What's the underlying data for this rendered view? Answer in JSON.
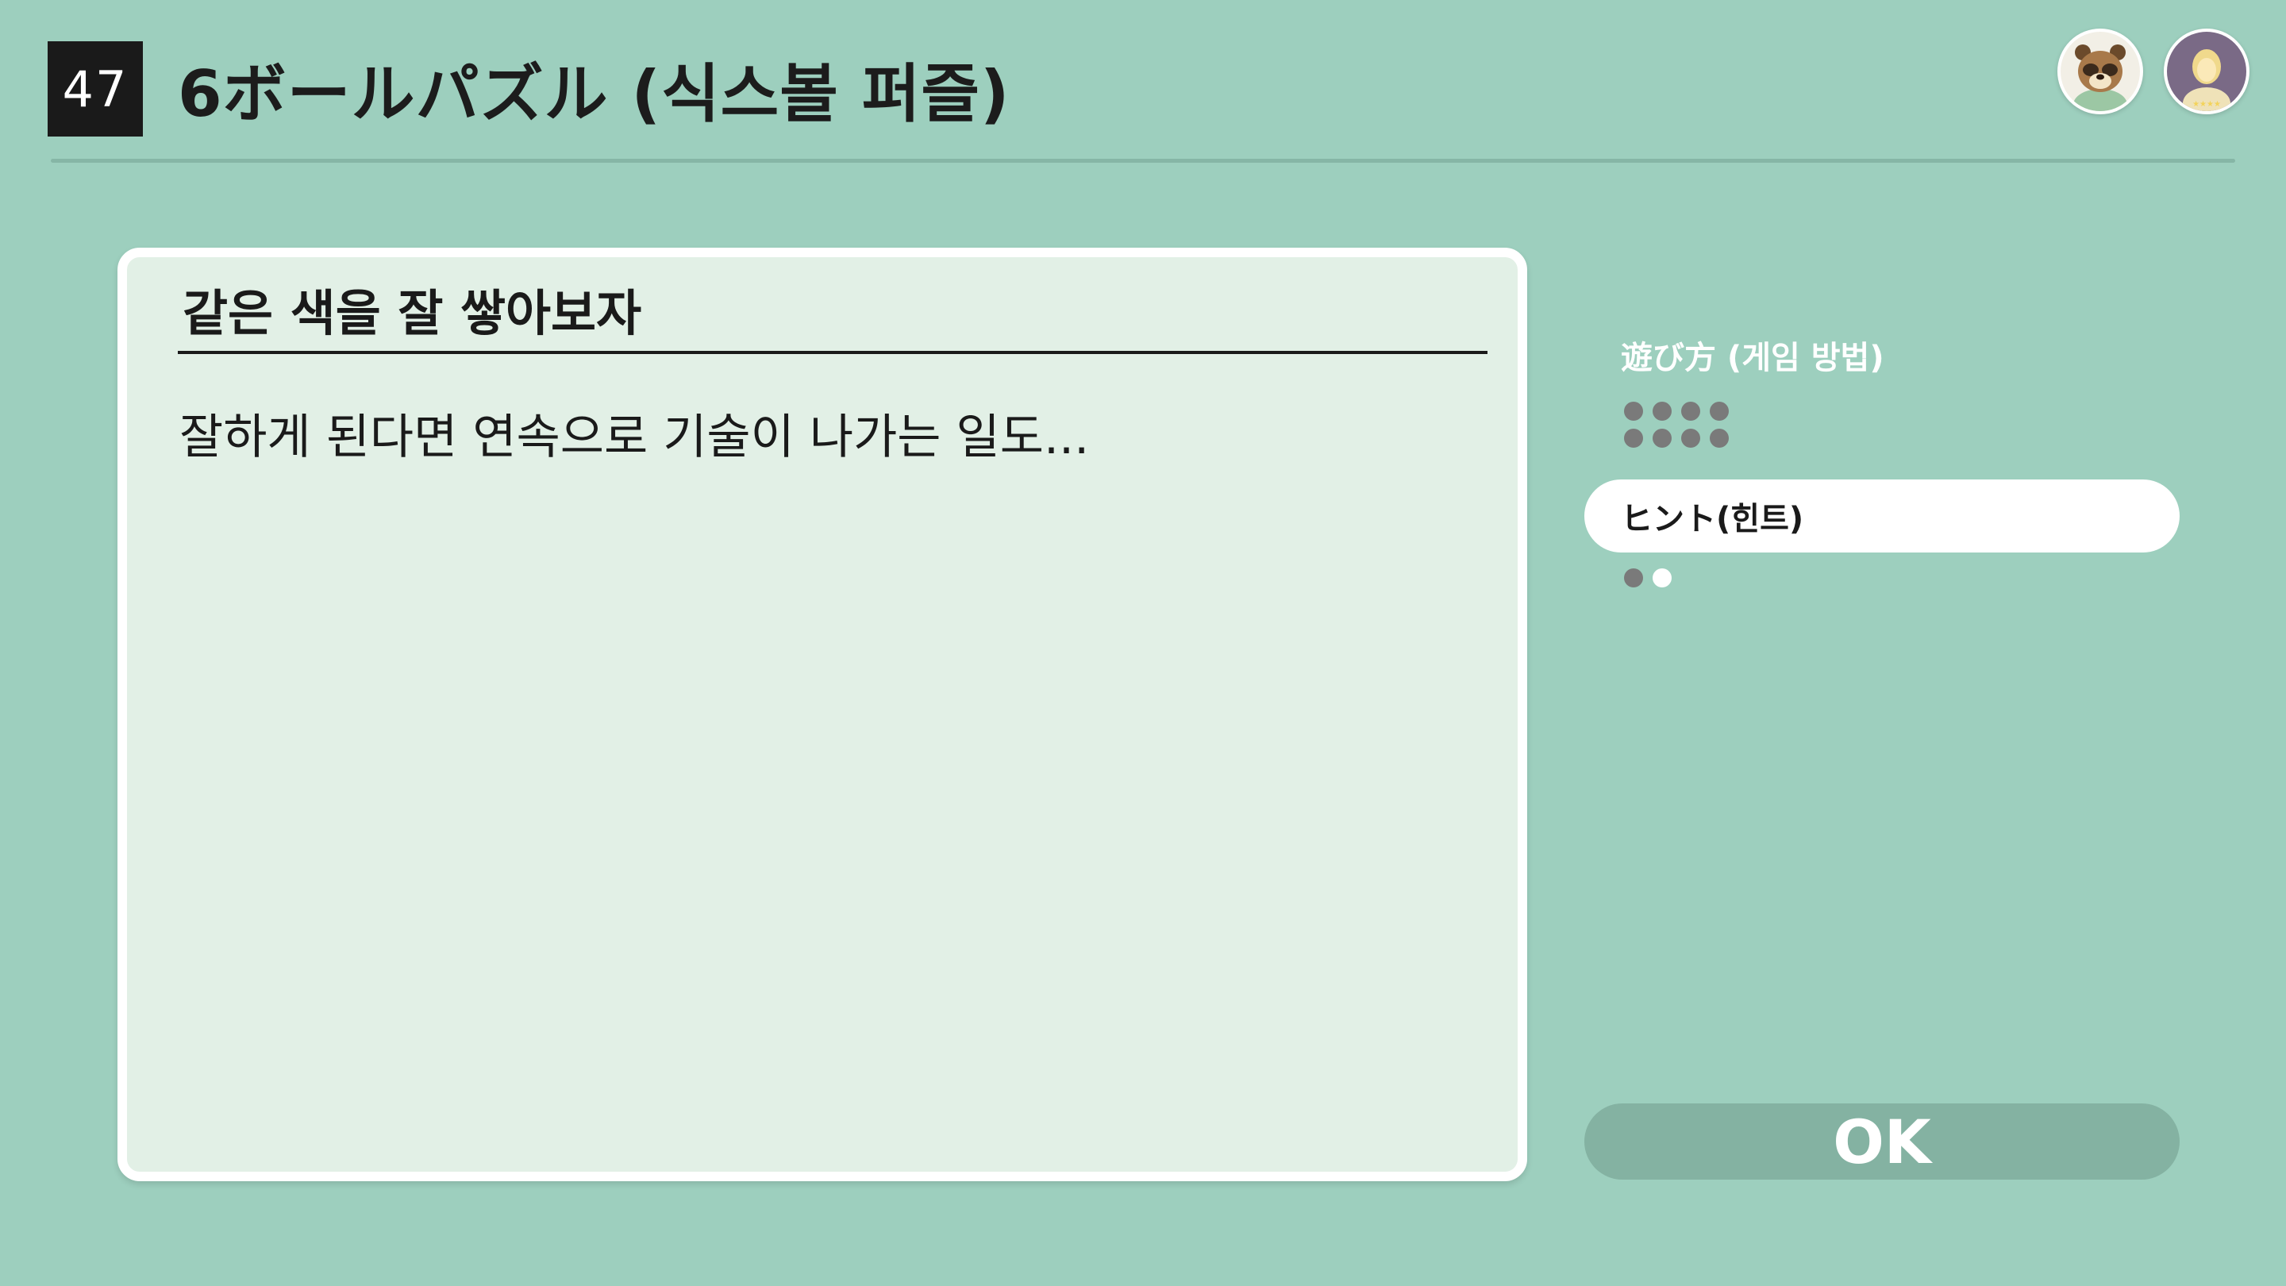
{
  "header": {
    "game_number": "47",
    "title": "6ボールパズル (식스볼 퍼즐)"
  },
  "avatars": [
    {
      "icon": "tom-nook-avatar-icon"
    },
    {
      "icon": "player-avatar-icon"
    }
  ],
  "card": {
    "title": "같은 색을 잘 쌓아보자",
    "body": "잘하게 된다면 연속으로 기술이 나가는 일도..."
  },
  "menu": {
    "items": [
      {
        "label": "遊び方 (게임 방법)",
        "active": false,
        "pages": 8,
        "current_page": null
      },
      {
        "label": "ヒント(힌트)",
        "active": true,
        "pages": 2,
        "current_page": 2
      }
    ]
  },
  "ok_button": {
    "label": "OK"
  },
  "colors": {
    "background": "#9dcfbe",
    "card": "#e2f0e6",
    "ok_button": "#84b2a2",
    "dot_inactive": "#7a7a7a",
    "dot_active": "#ffffff"
  }
}
